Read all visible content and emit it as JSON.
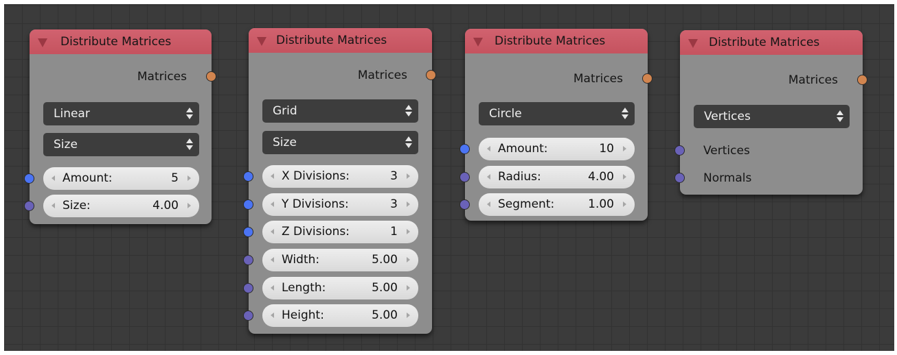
{
  "nodes": [
    {
      "title": "Distribute Matrices",
      "output": "Matrices",
      "dropdowns": [
        "Linear",
        "Size"
      ],
      "fields": [
        {
          "label": "Amount:",
          "value": "5"
        },
        {
          "label": "Size:",
          "value": "4.00"
        }
      ]
    },
    {
      "title": "Distribute Matrices",
      "output": "Matrices",
      "dropdowns": [
        "Grid",
        "Size"
      ],
      "fields": [
        {
          "label": "X Divisions:",
          "value": "3"
        },
        {
          "label": "Y Divisions:",
          "value": "3"
        },
        {
          "label": "Z Divisions:",
          "value": "1"
        },
        {
          "label": "Width:",
          "value": "5.00"
        },
        {
          "label": "Length:",
          "value": "5.00"
        },
        {
          "label": "Height:",
          "value": "5.00"
        }
      ]
    },
    {
      "title": "Distribute Matrices",
      "output": "Matrices",
      "dropdowns": [
        "Circle"
      ],
      "fields": [
        {
          "label": "Amount:",
          "value": "10"
        },
        {
          "label": "Radius:",
          "value": "4.00"
        },
        {
          "label": "Segment:",
          "value": "1.00"
        }
      ]
    },
    {
      "title": "Distribute Matrices",
      "output": "Matrices",
      "dropdowns": [
        "Vertices"
      ],
      "inputs": [
        "Vertices",
        "Normals"
      ]
    }
  ],
  "colors": {
    "header": "#c85a66",
    "node_body": "#8d8d8d",
    "socket_matrix": "#d2854f",
    "socket_int": "#4b74f4",
    "socket_float": "#6a62b8",
    "background": "#3b3b3b"
  }
}
